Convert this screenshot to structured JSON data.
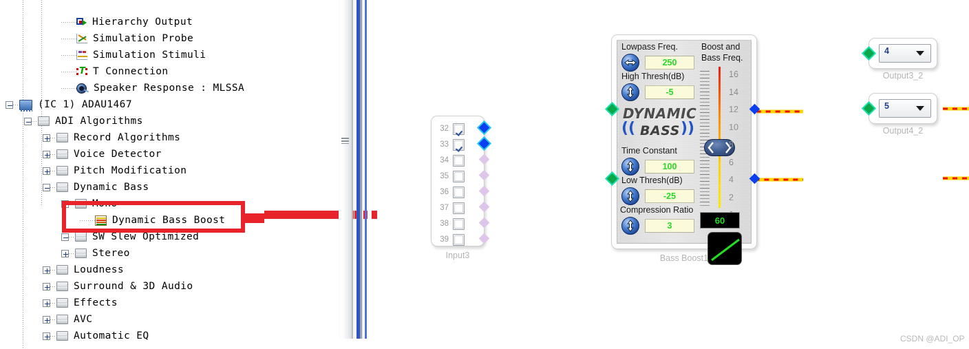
{
  "tree": {
    "items": [
      {
        "label": "Hierarchy Output",
        "icon": "hierarchy-output-icon",
        "indent": 3,
        "expander": "none"
      },
      {
        "label": "Simulation Probe",
        "icon": "simulation-probe-icon",
        "indent": 3,
        "expander": "none"
      },
      {
        "label": "Simulation Stimuli",
        "icon": "simulation-stimuli-icon",
        "indent": 3,
        "expander": "none"
      },
      {
        "label": "T Connection",
        "icon": "t-connection-icon",
        "indent": 3,
        "expander": "none"
      },
      {
        "label": "Speaker Response : MLSSA",
        "icon": "speaker-response-icon",
        "indent": 3,
        "expander": "none"
      },
      {
        "label": "(IC 1) ADAU1467",
        "icon": "ic-chip-icon",
        "indent": 0,
        "expander": "minus"
      },
      {
        "label": "ADI Algorithms",
        "icon": "folder-icon",
        "indent": 1,
        "expander": "minus"
      },
      {
        "label": "Record Algorithms",
        "icon": "folder-icon",
        "indent": 2,
        "expander": "plus"
      },
      {
        "label": "Voice Detector",
        "icon": "folder-icon",
        "indent": 2,
        "expander": "plus"
      },
      {
        "label": "Pitch Modification",
        "icon": "folder-icon",
        "indent": 2,
        "expander": "plus"
      },
      {
        "label": "Dynamic Bass",
        "icon": "folder-icon",
        "indent": 2,
        "expander": "minus"
      },
      {
        "label": "Mono",
        "icon": "folder-icon",
        "indent": 3,
        "expander": "minus"
      },
      {
        "label": "Dynamic Bass Boost",
        "icon": "waveform-icon",
        "indent": 4,
        "expander": "none"
      },
      {
        "label": "SW Slew Optimized",
        "icon": "folder-icon",
        "indent": 3,
        "expander": "minus"
      },
      {
        "label": "Stereo",
        "icon": "folder-icon",
        "indent": 3,
        "expander": "plus"
      },
      {
        "label": "Loudness",
        "icon": "folder-icon",
        "indent": 2,
        "expander": "plus"
      },
      {
        "label": "Surround & 3D Audio",
        "icon": "folder-icon",
        "indent": 2,
        "expander": "plus"
      },
      {
        "label": "Effects",
        "icon": "folder-icon",
        "indent": 2,
        "expander": "plus"
      },
      {
        "label": "AVC",
        "icon": "folder-icon",
        "indent": 2,
        "expander": "plus"
      },
      {
        "label": "Automatic EQ",
        "icon": "folder-icon",
        "indent": 2,
        "expander": "plus"
      }
    ],
    "highlighted_item": "Dynamic Bass Boost",
    "annotation_color": "#e8232a"
  },
  "input_block": {
    "caption": "Input3",
    "channels": [
      {
        "number": "32",
        "checked": true
      },
      {
        "number": "33",
        "checked": true
      },
      {
        "number": "34",
        "checked": false
      },
      {
        "number": "35",
        "checked": false
      },
      {
        "number": "36",
        "checked": false
      },
      {
        "number": "37",
        "checked": false
      },
      {
        "number": "38",
        "checked": false
      },
      {
        "number": "39",
        "checked": false
      }
    ]
  },
  "dynamic_bass": {
    "caption": "Bass Boost1",
    "logo_line1": "DYNAMIC",
    "logo_line2": "BASS",
    "paren_left": "((",
    "paren_right": "))",
    "controls": [
      {
        "label": "Lowpass Freq.",
        "value": "250",
        "knob": "horizontal"
      },
      {
        "label": "High Thresh(dB)",
        "value": "-5",
        "knob": "vertical"
      },
      {
        "label": "Time Constant",
        "value": "100",
        "knob": "vertical"
      },
      {
        "label": "Low Thresh(dB)",
        "value": "-25",
        "knob": "vertical"
      },
      {
        "label": "Compression Ratio",
        "value": "3",
        "knob": "vertical"
      }
    ],
    "slider": {
      "label_line1": "Boost and",
      "label_line2": "Bass Freq.",
      "scale": [
        "16",
        "14",
        "12",
        "10",
        "8",
        "6",
        "4",
        "2",
        "0"
      ],
      "value": 6
    },
    "readout": "60",
    "value_color": "#27d927"
  },
  "outputs": [
    {
      "caption": "Output3_2",
      "value": "4"
    },
    {
      "caption": "Output4_2",
      "value": "5"
    }
  ],
  "watermark": "CSDN @ADI_OP"
}
